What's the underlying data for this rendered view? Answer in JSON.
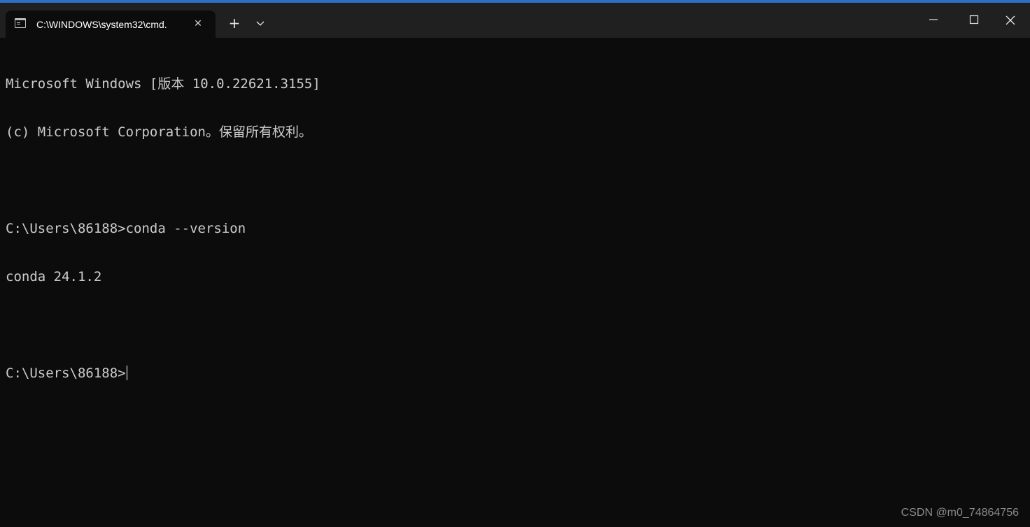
{
  "window": {
    "tab_title": "C:\\WINDOWS\\system32\\cmd.",
    "tab_icon": "terminal-icon",
    "close_tab_icon": "close-icon",
    "new_tab_symbol": "+",
    "dropdown_icon": "chevron-down-icon",
    "controls": [
      "minimize-icon",
      "maximize-icon",
      "close-icon"
    ]
  },
  "console": {
    "lines": [
      "Microsoft Windows [版本 10.0.22621.3155]",
      "(c) Microsoft Corporation。保留所有权利。",
      "",
      "C:\\Users\\86188>conda --version",
      "conda 24.1.2",
      "",
      "C:\\Users\\86188>"
    ]
  },
  "watermark": "CSDN @m0_74864756",
  "colors": {
    "titlebar": "#202020",
    "background": "#0c0c0c",
    "text": "#cccccc"
  }
}
